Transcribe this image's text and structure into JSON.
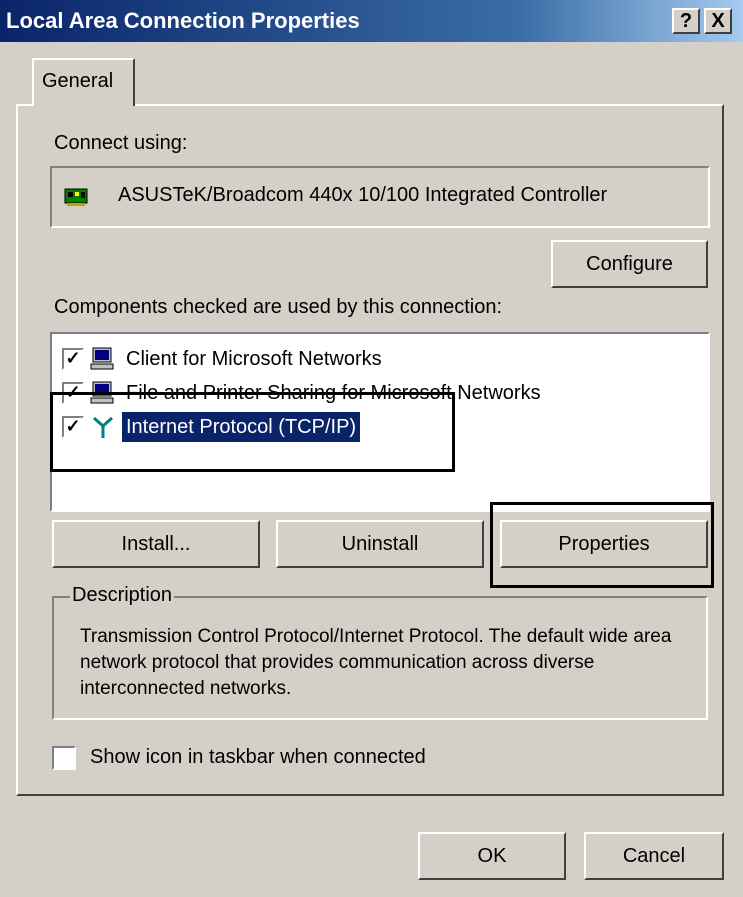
{
  "window": {
    "title": "Local Area Connection Properties",
    "help_label": "?",
    "close_label": "X"
  },
  "tabs": [
    {
      "label": "General"
    }
  ],
  "connect_using": {
    "label": "Connect using:",
    "adapter_name": "ASUSTeK/Broadcom 440x 10/100 Integrated Controller",
    "configure_label": "Configure"
  },
  "components": {
    "label": "Components checked are used by this connection:",
    "items": [
      {
        "label": "Client for Microsoft Networks",
        "checked": true,
        "icon": "network-client-icon"
      },
      {
        "label": "File and Printer Sharing for Microsoft Networks",
        "checked": true,
        "icon": "file-printer-sharing-icon"
      },
      {
        "label": "Internet Protocol (TCP/IP)",
        "checked": true,
        "icon": "protocol-icon",
        "selected": true
      }
    ],
    "install_label": "Install...",
    "uninstall_label": "Uninstall",
    "properties_label": "Properties"
  },
  "description": {
    "legend": "Description",
    "text": "Transmission Control Protocol/Internet Protocol. The default wide area network protocol that provides communication across diverse interconnected networks."
  },
  "show_icon": {
    "label": "Show icon in taskbar when connected",
    "checked": false
  },
  "footer": {
    "ok_label": "OK",
    "cancel_label": "Cancel"
  },
  "colors": {
    "title_bar": "#0a246a",
    "selection": "#0a246a",
    "face": "#d4d0c8"
  }
}
